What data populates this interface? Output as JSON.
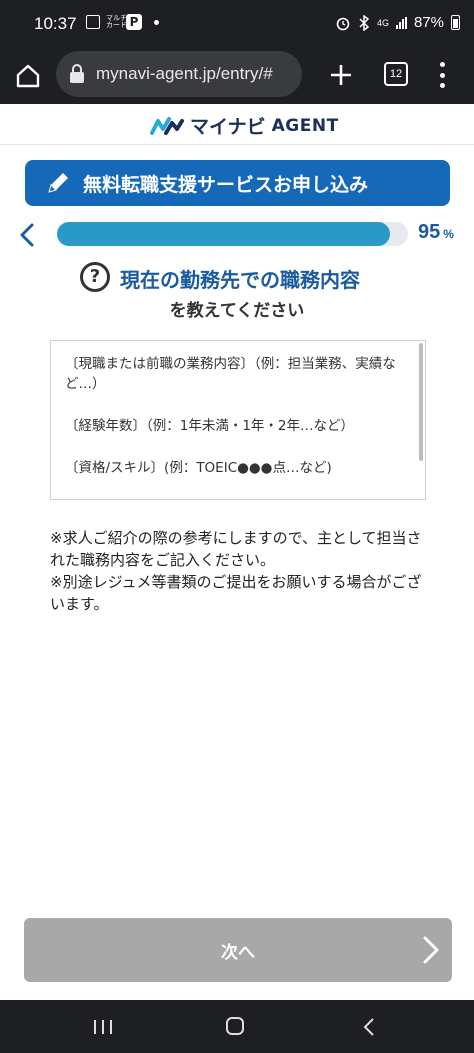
{
  "status_bar": {
    "time": "10:37",
    "notif_text_icon": "マルチ\nカード",
    "notif_p_icon": "P",
    "network": "4G",
    "battery_percent": "87%"
  },
  "browser": {
    "url": "mynavi-agent.jp/entry/#",
    "tab_count": "12"
  },
  "logo": {
    "jp": "マイナビ",
    "en": "AGENT"
  },
  "banner": {
    "title": "無料転職支援サービスお申し込み"
  },
  "progress": {
    "value": 95,
    "number": "95",
    "unit": "%"
  },
  "question": {
    "icon_char": "?",
    "title": "現在の勤務先での職務内容",
    "subtitle": "を教えてください"
  },
  "textarea": {
    "placeholder_lines": [
      "〔現職または前職の業務内容〕（例：担当業務、実績など…）",
      "〔経験年数〕（例：1年未満・1年・2年…など）",
      "〔資格/スキル〕(例：TOEIC●●●点…など)"
    ]
  },
  "notes": [
    "※求人ご紹介の際の参考にしますので、主として担当された職務内容をご記入ください。",
    "※別途レジュメ等書類のご提出をお願いする場合がございます。"
  ],
  "next_button": {
    "label": "次へ"
  },
  "colors": {
    "brand_blue": "#1669b8",
    "progress_fill": "#2a99c8",
    "title_blue": "#1a5aa0",
    "disabled_button": "#a8a8a8"
  }
}
